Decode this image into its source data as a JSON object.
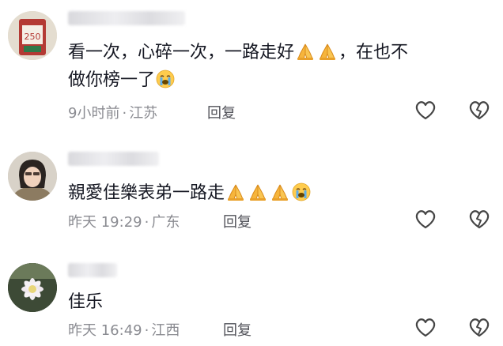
{
  "comments": [
    {
      "text_line1": "看一次，心碎一次，一路走好",
      "text_mid": "，在也不",
      "text_line2": "做你榜一了",
      "time": "9小时前",
      "location": "江苏",
      "reply_label": "回复",
      "avatar_tag": "250"
    },
    {
      "text": "親愛佳樂表弟一路走",
      "time": "昨天 19:29",
      "location": "广东",
      "reply_label": "回复"
    },
    {
      "text": "佳乐",
      "time": "昨天 16:49",
      "location": "江西",
      "reply_label": "回复"
    }
  ],
  "meta_separator": "·",
  "icons": {
    "like": "heart-outline-icon",
    "dislike": "broken-heart-icon",
    "pray": "folded-hands-emoji",
    "cry": "loudly-crying-emoji"
  },
  "colors": {
    "text": "#161823",
    "meta": "#8a8b91",
    "reply": "#505158",
    "icon": "#444444"
  }
}
